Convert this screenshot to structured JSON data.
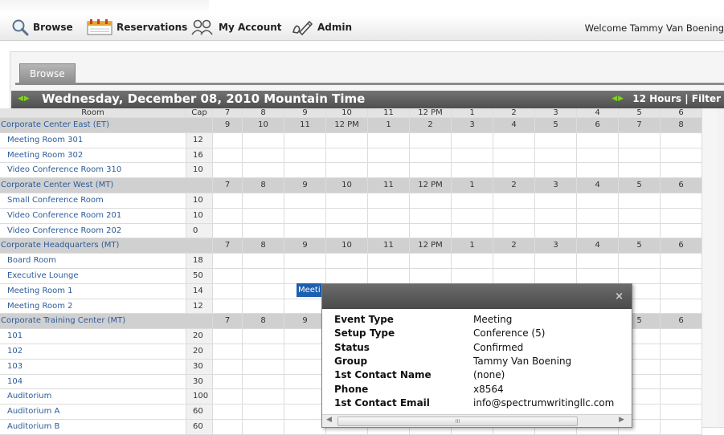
{
  "nav": {
    "items": [
      {
        "label": "Browse",
        "icon": "magnifier-icon"
      },
      {
        "label": "Reservations",
        "icon": "calendar-icon"
      },
      {
        "label": "My Account",
        "icon": "users-icon"
      },
      {
        "label": "Admin",
        "icon": "pen-icon"
      }
    ],
    "welcome": "Welcome Tammy Van Boening"
  },
  "tab": {
    "label": "Browse"
  },
  "calendar": {
    "title": "Wednesday, December 08, 2010 Mountain Time",
    "hours_label": "12 Hours",
    "filter_label": "Filter",
    "separator": "|",
    "room_header": "Room",
    "cap_header": "Cap",
    "time_headers": [
      "7",
      "8",
      "9",
      "10",
      "11",
      "12 PM",
      "1",
      "2",
      "3",
      "4",
      "5",
      "6"
    ],
    "groups": [
      {
        "name": "Corporate Center East (ET)",
        "times": [
          "9",
          "10",
          "11",
          "12 PM",
          "1",
          "2",
          "3",
          "4",
          "5",
          "6",
          "7",
          "8"
        ],
        "rooms": [
          {
            "name": "Meeting Room 301",
            "cap": "12"
          },
          {
            "name": "Meeting Room 302",
            "cap": "16"
          },
          {
            "name": "Video Conference Room 310",
            "cap": "10"
          }
        ]
      },
      {
        "name": "Corporate Center West (MT)",
        "times": [
          "7",
          "8",
          "9",
          "10",
          "11",
          "12 PM",
          "1",
          "2",
          "3",
          "4",
          "5",
          "6"
        ],
        "rooms": [
          {
            "name": "Small Conference Room",
            "cap": "10"
          },
          {
            "name": "Video Conference Room 201",
            "cap": "10"
          },
          {
            "name": "Video Conference Room 202",
            "cap": "0"
          }
        ]
      },
      {
        "name": "Corporate Headquarters (MT)",
        "times": [
          "7",
          "8",
          "9",
          "10",
          "11",
          "12 PM",
          "1",
          "2",
          "3",
          "4",
          "5",
          "6"
        ],
        "rooms": [
          {
            "name": "Board Room",
            "cap": "18"
          },
          {
            "name": "Executive Lounge",
            "cap": "50"
          },
          {
            "name": "Meeting Room 1",
            "cap": "14"
          },
          {
            "name": "Meeting Room 2",
            "cap": "12"
          }
        ]
      },
      {
        "name": "Corporate Training Center (MT)",
        "times": [
          "7",
          "8",
          "9",
          "",
          "",
          "",
          "",
          "",
          "",
          "",
          "5",
          "6"
        ],
        "rooms": [
          {
            "name": "101",
            "cap": "20"
          },
          {
            "name": "102",
            "cap": "20"
          },
          {
            "name": "103",
            "cap": "30"
          },
          {
            "name": "104",
            "cap": "30"
          },
          {
            "name": "Auditorium",
            "cap": "100"
          },
          {
            "name": "Auditorium A",
            "cap": "60"
          },
          {
            "name": "Auditorium B",
            "cap": "60"
          }
        ]
      }
    ],
    "booking_label": "Meeti"
  },
  "popup": {
    "close": "×",
    "rows": [
      {
        "label": "Event Type",
        "value": "Meeting"
      },
      {
        "label": "Setup Type",
        "value": "Conference (5)"
      },
      {
        "label": "Status",
        "value": "Confirmed"
      },
      {
        "label": "Group",
        "value": "Tammy Van Boening"
      },
      {
        "label": "1st Contact Name",
        "value": "(none)"
      },
      {
        "label": "Phone",
        "value": "x8564"
      },
      {
        "label": "1st Contact Email",
        "value": "info@spectrumwritingllc.com"
      }
    ],
    "scroll_grip": "III"
  }
}
